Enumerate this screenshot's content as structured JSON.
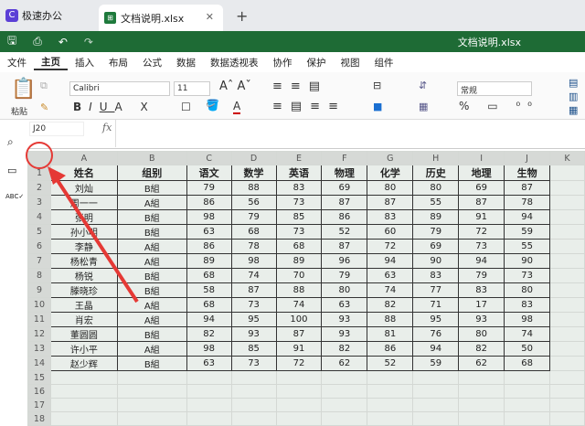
{
  "tabs": {
    "app": "极速办公",
    "doc": "文档说明.xlsx"
  },
  "titlebar": {
    "title": "文档说明.xlsx"
  },
  "menu": [
    "文件",
    "主页",
    "插入",
    "布局",
    "公式",
    "数据",
    "数据透视表",
    "协作",
    "保护",
    "视图",
    "组件"
  ],
  "toolbar": {
    "paste": "粘贴",
    "font": "Calibri",
    "size": "11",
    "format": "常规"
  },
  "formula": {
    "cell_ref": "J20",
    "fx": "fx",
    "value": ""
  },
  "columns": [
    "A",
    "B",
    "C",
    "D",
    "E",
    "F",
    "G",
    "H",
    "I",
    "J",
    "K"
  ],
  "rows": [
    [
      "姓名",
      "组别",
      "语文",
      "数学",
      "英语",
      "物理",
      "化学",
      "历史",
      "地理",
      "生物"
    ],
    [
      "刘灿",
      "B組",
      "79",
      "88",
      "83",
      "69",
      "80",
      "80",
      "69",
      "87"
    ],
    [
      "周一一",
      "A組",
      "86",
      "56",
      "73",
      "87",
      "87",
      "55",
      "87",
      "78"
    ],
    [
      "张明",
      "B組",
      "98",
      "79",
      "85",
      "86",
      "83",
      "89",
      "91",
      "94"
    ],
    [
      "孙小明",
      "B組",
      "63",
      "68",
      "73",
      "52",
      "60",
      "79",
      "72",
      "59"
    ],
    [
      "李静",
      "A組",
      "86",
      "78",
      "68",
      "87",
      "72",
      "69",
      "73",
      "55"
    ],
    [
      "杨松青",
      "A組",
      "89",
      "98",
      "89",
      "96",
      "94",
      "90",
      "94",
      "90"
    ],
    [
      "杨锐",
      "B組",
      "68",
      "74",
      "70",
      "79",
      "63",
      "83",
      "79",
      "73"
    ],
    [
      "滕晓珍",
      "B組",
      "58",
      "87",
      "88",
      "80",
      "74",
      "77",
      "83",
      "80"
    ],
    [
      "王晶",
      "A組",
      "68",
      "73",
      "74",
      "63",
      "82",
      "71",
      "17",
      "83"
    ],
    [
      "肖宏",
      "A組",
      "94",
      "95",
      "100",
      "93",
      "88",
      "95",
      "93",
      "98"
    ],
    [
      "董圆圆",
      "B組",
      "82",
      "93",
      "87",
      "93",
      "81",
      "76",
      "80",
      "74"
    ],
    [
      "许小平",
      "A組",
      "98",
      "85",
      "91",
      "82",
      "86",
      "94",
      "82",
      "50"
    ],
    [
      "赵少辉",
      "B組",
      "63",
      "73",
      "72",
      "62",
      "52",
      "59",
      "62",
      "68"
    ]
  ],
  "empty_rows": [
    "15",
    "16",
    "17",
    "18"
  ],
  "colors": {
    "brand_green": "#1e6b35",
    "annotation_red": "#e53935"
  }
}
